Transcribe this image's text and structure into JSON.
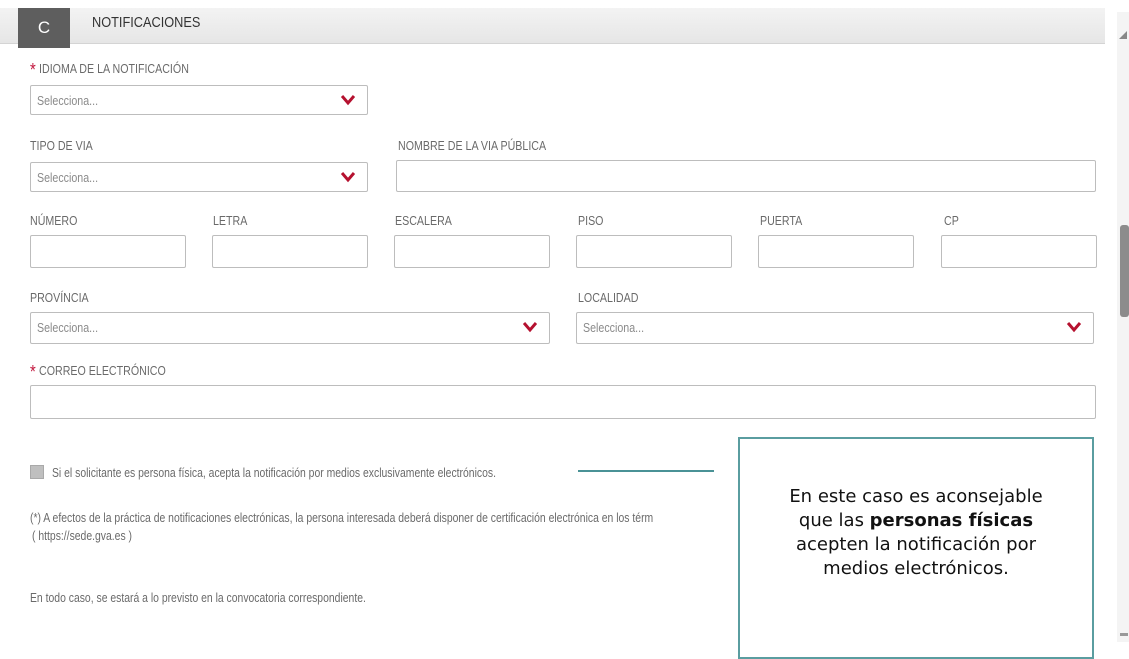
{
  "section": {
    "badge": "C",
    "title": "NOTIFICACIONES"
  },
  "fields": {
    "idioma": {
      "label": "IDIOMA DE LA NOTIFICACIÓN",
      "value": "Selecciona..."
    },
    "tipo_via": {
      "label": "TIPO DE VIA",
      "value": "Selecciona..."
    },
    "nombre_via": {
      "label": "NOMBRE DE LA VIA PÚBLICA",
      "value": ""
    },
    "numero": {
      "label": "NÚMERO"
    },
    "letra": {
      "label": "LETRA"
    },
    "escalera": {
      "label": "ESCALERA"
    },
    "piso": {
      "label": "PISO"
    },
    "puerta": {
      "label": "PUERTA"
    },
    "cp": {
      "label": "CP"
    },
    "provincia": {
      "label": "PROVÍNCIA",
      "value": "Selecciona..."
    },
    "localidad": {
      "label": "LOCALIDAD",
      "value": "Selecciona..."
    },
    "correo": {
      "label": "CORREO ELECTRÓNICO",
      "value": ""
    }
  },
  "consent": {
    "checkbox_label": "Si el solicitante es persona física, acepta la notificación por medios exclusivamente electrónicos.",
    "checked": false
  },
  "notes": {
    "electronic_line1": "(*) A efectos de la práctica de notificaciones electrónicas, la persona interesada deberá disponer de certificación electrónica en los térm",
    "electronic_line2": "( https://sede.gva.es )",
    "general": "En todo caso, se estará a lo previsto en la convocatoria correspondiente."
  },
  "callout": {
    "before": "En este caso es aconsejable que las ",
    "bold": "personas físicas",
    "after": " acepten la notificación por medios electrónicos."
  },
  "colors": {
    "required": "#c1133a",
    "chevron": "#b5112f",
    "callout_border": "#5a9da0"
  }
}
